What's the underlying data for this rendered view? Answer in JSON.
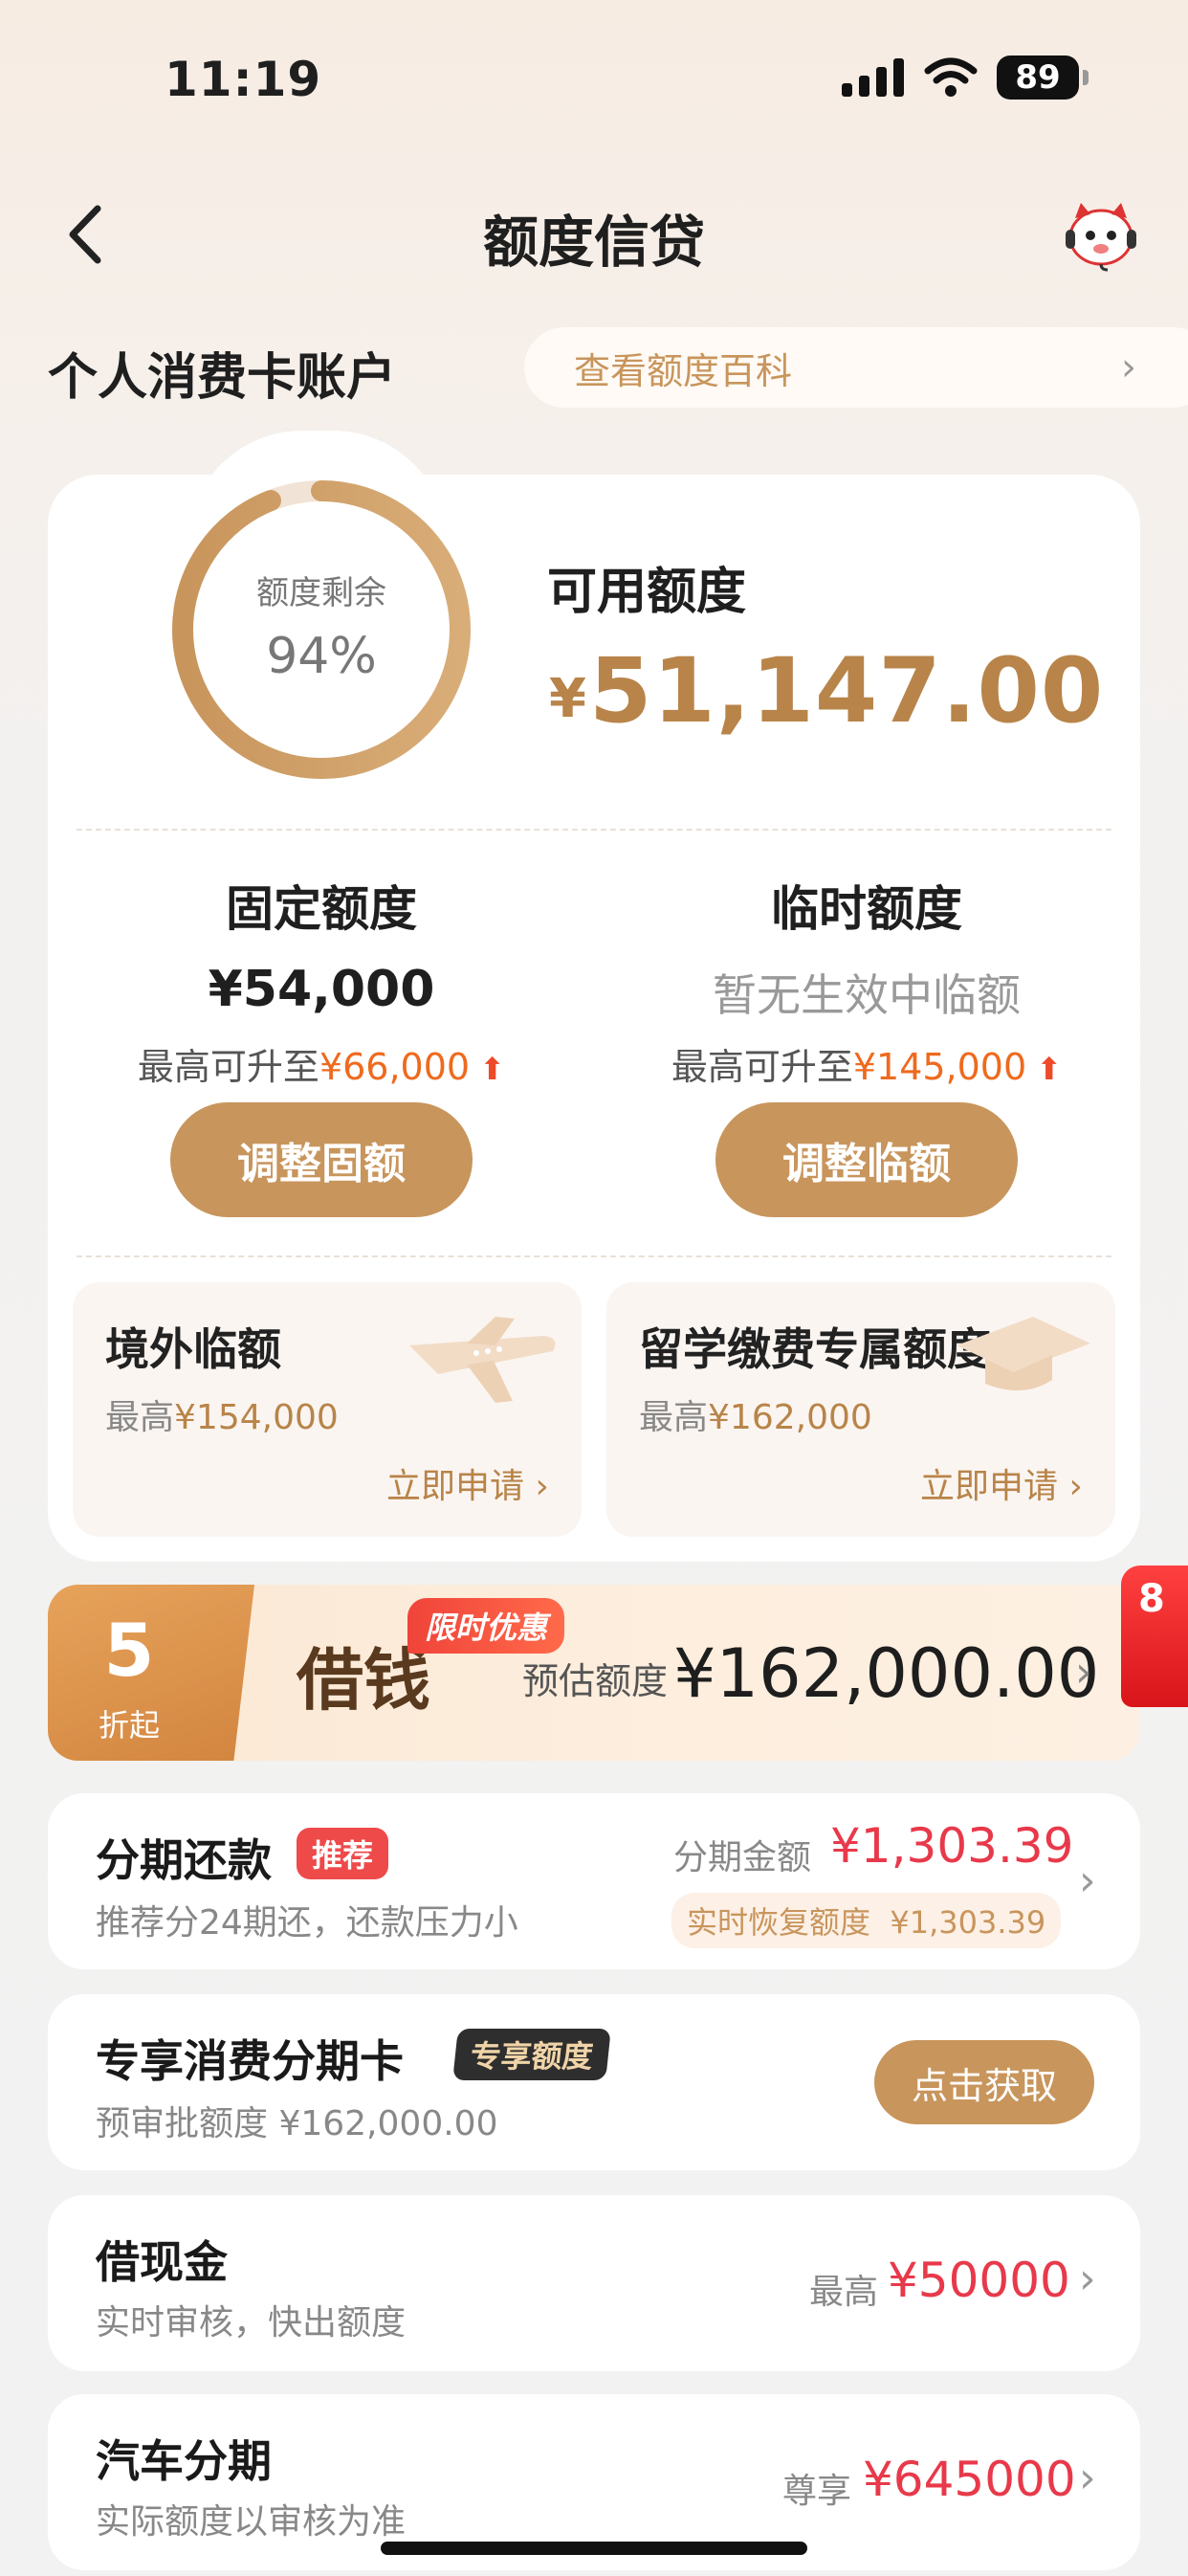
{
  "status": {
    "time": "11:19",
    "battery": "89"
  },
  "nav": {
    "title": "额度信贷"
  },
  "account": {
    "title": "个人消费卡账户",
    "wiki_link": "查看额度百科"
  },
  "summary": {
    "ring_label": "额度剩余",
    "remaining_percent": "94%",
    "remaining_fraction": 0.94,
    "available_label": "可用额度",
    "available_currency": "¥",
    "available_amount": "51,147.00"
  },
  "fixed": {
    "title": "固定额度",
    "value": "¥54,000",
    "upgrade_prefix": "最高可升至",
    "upgrade_value": "¥66,000",
    "button": "调整固额"
  },
  "temp": {
    "title": "临时额度",
    "value": "暂无生效中临额",
    "upgrade_prefix": "最高可升至",
    "upgrade_value": "¥145,000",
    "button": "调整临额"
  },
  "overseas": {
    "title": "境外临额",
    "max_prefix": "最高",
    "max_value": "¥154,000",
    "link": "立即申请 ›"
  },
  "study": {
    "title": "留学缴费专属额度",
    "max_prefix": "最高",
    "max_value": "¥162,000",
    "link": "立即申请 ›"
  },
  "banner": {
    "discount_num": "5",
    "discount_suffix": "折起",
    "product": "借钱",
    "tag": "限时优惠",
    "estimate_label": "预估额度",
    "estimate_value": "¥162,000.00",
    "side_badge": "8"
  },
  "installment": {
    "title": "分期还款",
    "badge": "推荐",
    "subtitle": "推荐分24期还，还款压力小",
    "amount_label": "分期金额",
    "amount_value": "¥1,303.39",
    "restore_label": "实时恢复额度",
    "restore_value": "¥1,303.39"
  },
  "card_install": {
    "title": "专享消费分期卡",
    "badge": "专享额度",
    "subtitle": "预审批额度 ¥162,000.00",
    "button": "点击获取"
  },
  "cash": {
    "title": "借现金",
    "subtitle": "实时审核，快出额度",
    "right_label": "最高",
    "right_value": "¥50000"
  },
  "auto": {
    "title": "汽车分期",
    "subtitle": "实际额度以审核为准",
    "right_label": "尊享",
    "right_value": "¥645000"
  },
  "colors": {
    "gold": "#c8955c",
    "red": "#e8394a",
    "orange": "#ee6a1e"
  }
}
